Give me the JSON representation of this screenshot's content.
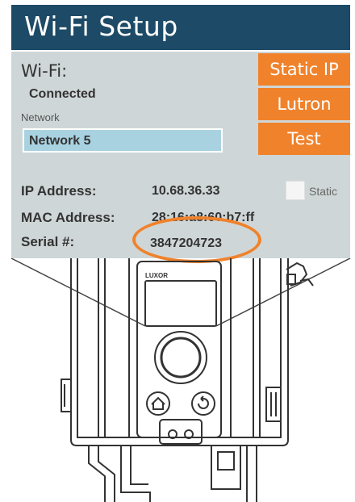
{
  "header": {
    "title": "Wi-Fi Setup"
  },
  "wifi": {
    "label": "Wi-Fi:",
    "status": "Connected",
    "network_label": "Network",
    "network_value": "Network 5"
  },
  "buttons": {
    "static_ip": "Static IP",
    "lutron": "Lutron",
    "test": "Test"
  },
  "info": {
    "ip_label": "IP Address:",
    "ip_value": "10.68.36.33",
    "static_label": "Static",
    "mac_label": "MAC Address:",
    "mac_value": "28:16:a8:60:b7:ff",
    "serial_label": "Serial #:",
    "serial_value": "3847204723"
  },
  "device": {
    "brand": "LUXOR"
  },
  "colors": {
    "header_bg": "#1d4a66",
    "panel_bg": "#cfd6d7",
    "accent": "#f0822b",
    "field_bg": "#a9d2e1"
  }
}
